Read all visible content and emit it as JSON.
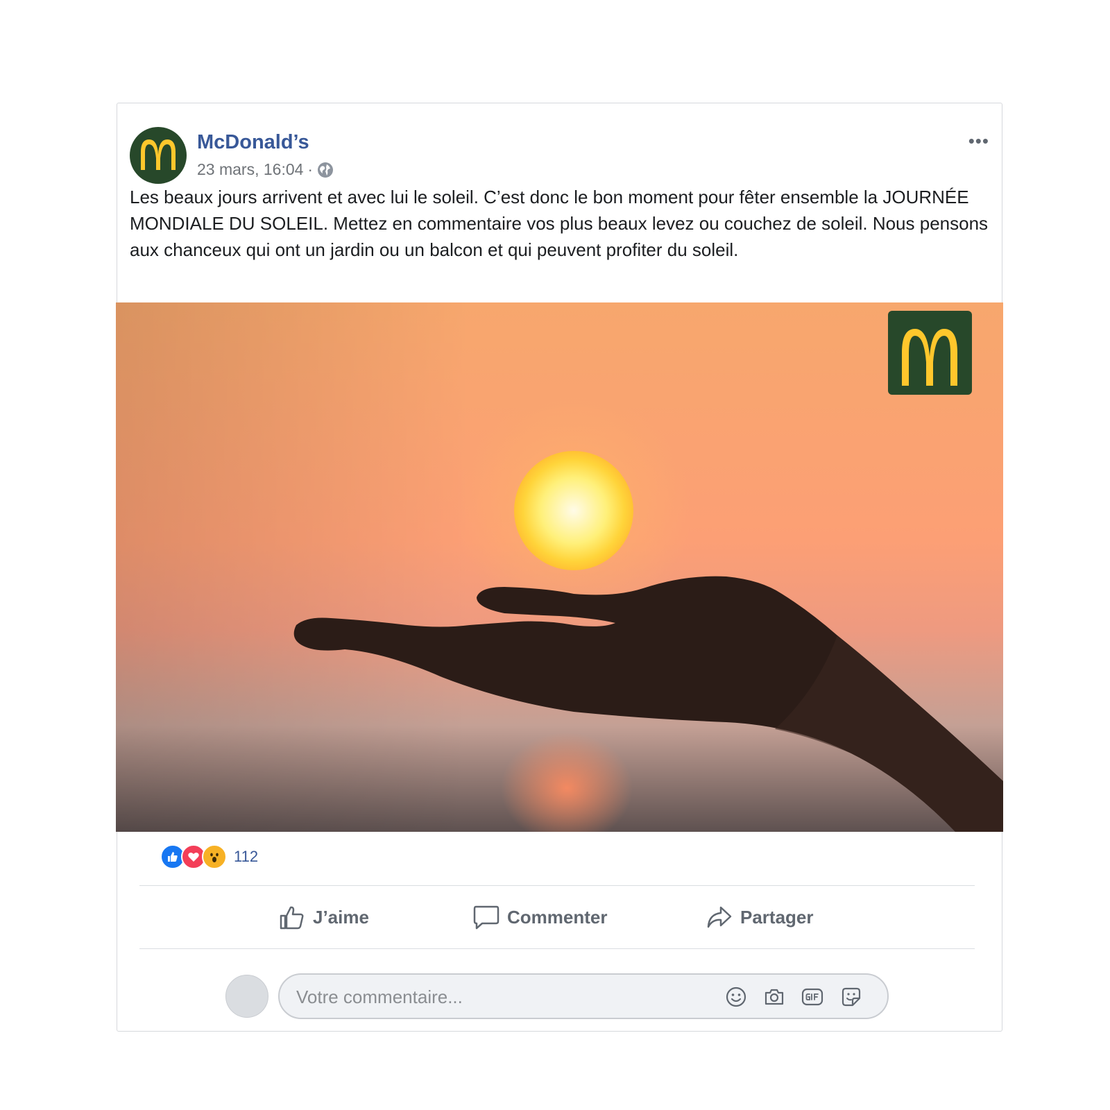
{
  "post": {
    "page_name": "McDonald’s",
    "timestamp": "23 mars, 16:04",
    "separator": "·",
    "audience_icon": "globe-icon",
    "more_label": "•••",
    "text": "Les beaux jours arrivent et avec lui le soleil. C’est donc le bon moment pour fêter ensemble la JOURNÉE MONDIALE DU SOLEIL. Mettez en commentaire vos plus beaux levez ou couchez de soleil. Nous pensons aux chanceux qui ont un jardin ou un balcon et qui peuvent profiter du soleil."
  },
  "reactions": {
    "icons": [
      "like-icon",
      "love-icon",
      "wow-icon"
    ],
    "count": "112"
  },
  "actions": {
    "like": "J’aime",
    "comment": "Commenter",
    "share": "Partager"
  },
  "comment": {
    "placeholder": "Votre commentaire...",
    "tools": [
      "emoji-icon",
      "camera-icon",
      "gif-icon",
      "sticker-icon"
    ]
  },
  "colors": {
    "brand_green": "#27482a",
    "brand_yellow": "#ffc72c",
    "link_blue": "#385898",
    "like_blue": "#1877f2",
    "love_red": "#f33e58",
    "wow_yellow": "#f7b125"
  }
}
